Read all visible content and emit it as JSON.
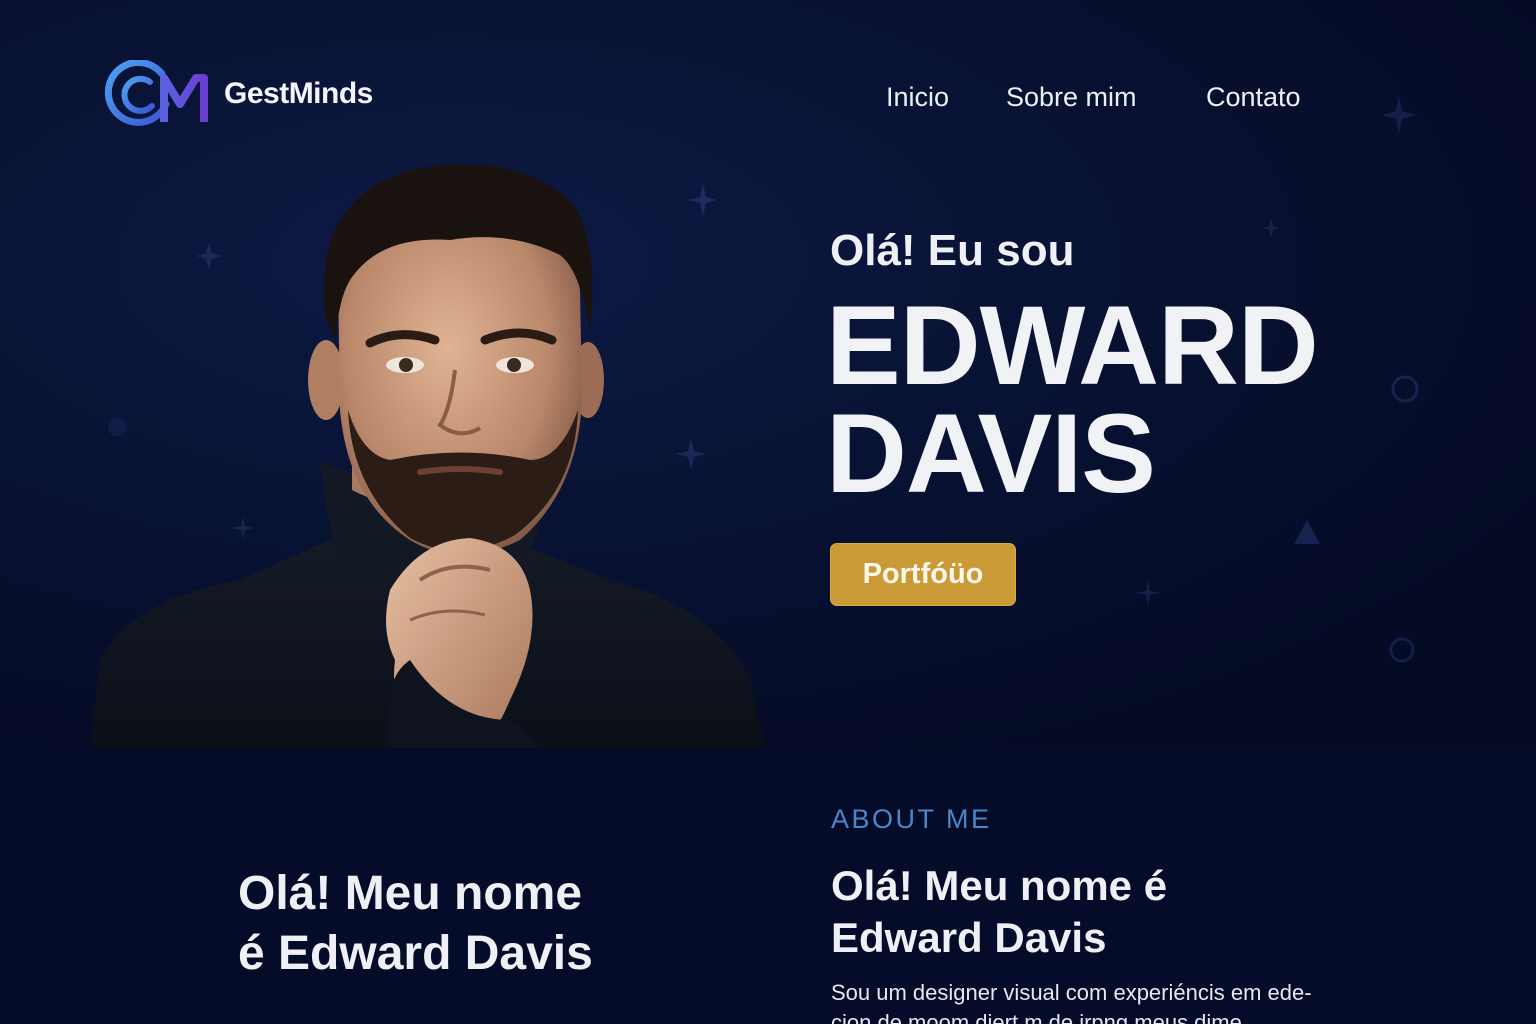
{
  "brand": {
    "name": "GestMinds",
    "mark_letters": "GM",
    "accent_color": "#4f6ee0"
  },
  "nav": {
    "items": [
      "Inicio",
      "Sobre mim",
      "Contato"
    ]
  },
  "hero": {
    "greeting": "Olá! Eu sou",
    "name_line1": "EDWARD",
    "name_line2": "DAVIS",
    "cta_label": "Portfóüo",
    "cta_color": "#c99a36",
    "portrait_icon": "portrait-photo"
  },
  "about": {
    "left_title_line1": "Olá! Meu nome",
    "left_title_line2": "é Edward Davis",
    "kicker": "ABOUT ME",
    "title_line1": "Olá! Meu nome é",
    "title_line2": "Edward Davis",
    "body_line1": "Sou um designer visual com experiéncis em ede-",
    "body_line2": "cion de moom diert m de irpng meus dime",
    "kicker_color": "#4c86c8"
  }
}
